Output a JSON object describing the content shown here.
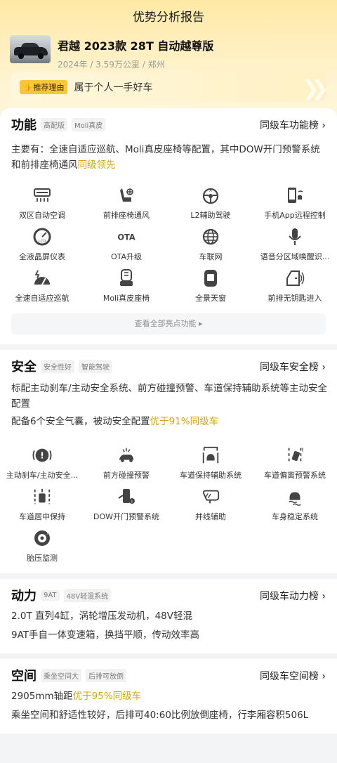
{
  "page_title": "优势分析报告",
  "car": {
    "name": "君越 2023款 28T 自动越尊版",
    "meta": "2024年 / 3.59万公里 / 郑州"
  },
  "reason": {
    "tag": "推荐理由",
    "text": "属于个人一手好车"
  },
  "function": {
    "title": "功能",
    "chips": [
      "高配版",
      "Moli真皮"
    ],
    "link": "同级车功能榜 ›",
    "desc_plain": "主要有：全速自适应巡航、Moli真皮座椅等配置，其中DOW开门预警系统和前排座椅通风",
    "desc_hl": "同级领先",
    "features": [
      {
        "icon": "climate-icon",
        "label": "双区自动空调"
      },
      {
        "icon": "seat-fan-icon",
        "label": "前排座椅通风"
      },
      {
        "icon": "steering-wheel-icon",
        "label": "L2辅助驾驶"
      },
      {
        "icon": "phone-car-icon",
        "label": "手机App远程控制"
      },
      {
        "icon": "gauge-icon",
        "label": "全液晶屏仪表"
      },
      {
        "icon": "ota-icon",
        "label": "OTA升级"
      },
      {
        "icon": "globe-icon",
        "label": "车联网"
      },
      {
        "icon": "microphone-icon",
        "label": "语音分区域唤醒识..."
      },
      {
        "icon": "cruise-icon",
        "label": "全速自适应巡航"
      },
      {
        "icon": "leather-seat-icon",
        "label": "Moli真皮座椅"
      },
      {
        "icon": "sunroof-icon",
        "label": "全景天窗"
      },
      {
        "icon": "keyless-door-icon",
        "label": "前排无钥匙进入"
      }
    ],
    "see_all": "查看全部亮点功能 ▸"
  },
  "safety": {
    "title": "安全",
    "chips": [
      "安全性好",
      "智能驾驶"
    ],
    "link": "同级车安全榜 ›",
    "desc1": "标配主动刹车/主动安全系统、前方碰撞预警、车道保持辅助系统等主动安全配置",
    "desc2_plain": "配备6个安全气囊，被动安全配置",
    "desc2_hl": "优于91%同级车",
    "features": [
      {
        "icon": "brake-alert-icon",
        "label": "主动刹车/主动安全..."
      },
      {
        "icon": "collision-icon",
        "label": "前方碰撞预警"
      },
      {
        "icon": "lane-keep-icon",
        "label": "车道保持辅助系统"
      },
      {
        "icon": "lane-depart-icon",
        "label": "车道偏离预警系统"
      },
      {
        "icon": "lane-center-icon",
        "label": "车道居中保持"
      },
      {
        "icon": "dow-icon",
        "label": "DOW开门预警系统"
      },
      {
        "icon": "mirror-icon",
        "label": "并线辅助"
      },
      {
        "icon": "stability-icon",
        "label": "车身稳定系统"
      },
      {
        "icon": "tire-icon",
        "label": "胎压监测"
      }
    ]
  },
  "power": {
    "title": "动力",
    "chips": [
      "9AT",
      "48V轻混系统"
    ],
    "link": "同级车动力榜 ›",
    "line1": "2.0T 直列4缸，涡轮增压发动机，48V轻混",
    "line2": "9AT手自一体变速箱，换挡平顺，传动效率高"
  },
  "space": {
    "title": "空间",
    "chips": [
      "乘坐空间大",
      "后排可放倒"
    ],
    "link": "同级车空间榜 ›",
    "line1_plain": "2905mm轴距",
    "line1_hl": "优于95%同级车",
    "line2": "乘坐空间和舒适性较好，后排可40:60比例放倒座椅，行李厢容积506L"
  }
}
